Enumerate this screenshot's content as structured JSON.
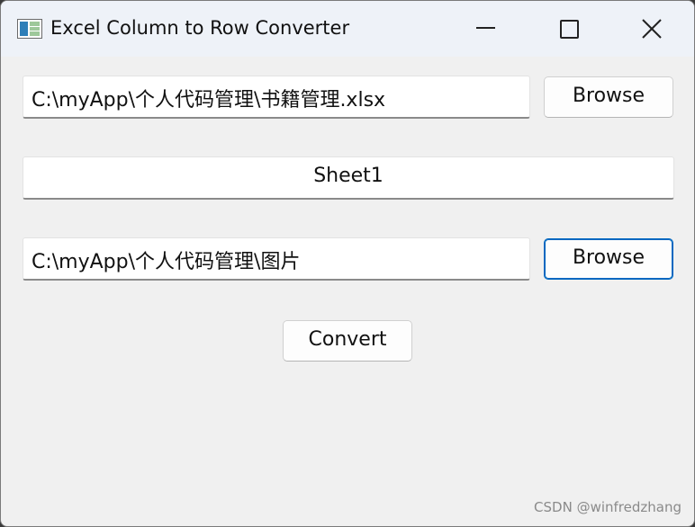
{
  "window": {
    "title": "Excel Column to Row Converter",
    "icon": "excel-spreadsheet-icon"
  },
  "title_bar_buttons": {
    "minimize_icon": "minimize-icon",
    "maximize_icon": "maximize-icon",
    "close_icon": "close-icon"
  },
  "form": {
    "excel_path": "C:\\myApp\\个人代码管理\\书籍管理.xlsx",
    "browse_excel_label": "Browse",
    "sheet_name": "Sheet1",
    "output_path": "C:\\myApp\\个人代码管理\\图片",
    "browse_output_label": "Browse",
    "convert_label": "Convert"
  },
  "watermark": "CSDN @winfredzhang",
  "colors": {
    "focus_accent": "#0067c0",
    "window_bg": "#f0f0f0",
    "titlebar_bg": "#eef2f8"
  }
}
